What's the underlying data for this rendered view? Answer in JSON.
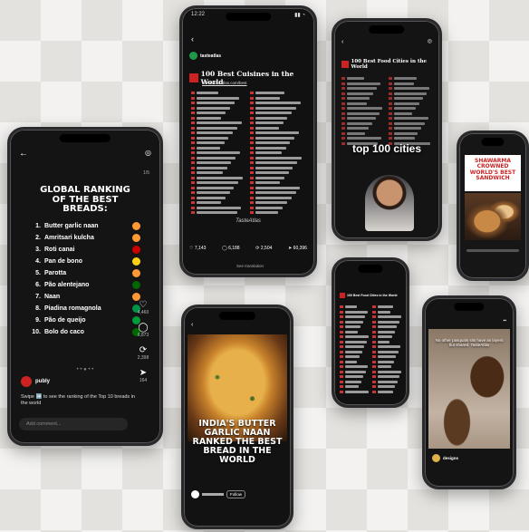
{
  "phone1": {
    "heading_line1": "GLOBAL RANKING",
    "heading_line2": "OF THE BEST BREADS:",
    "breads": [
      {
        "rank": "1.",
        "name": "Butter garlic naan",
        "color": "#ff9933"
      },
      {
        "rank": "2.",
        "name": "Amritsari kulcha",
        "color": "#ff9933"
      },
      {
        "rank": "3.",
        "name": "Roti canai",
        "color": "#cc0001"
      },
      {
        "rank": "4.",
        "name": "Pan de bono",
        "color": "#fcd116"
      },
      {
        "rank": "5.",
        "name": "Parotta",
        "color": "#ff9933"
      },
      {
        "rank": "6.",
        "name": "Pão alentejano",
        "color": "#006600"
      },
      {
        "rank": "7.",
        "name": "Naan",
        "color": "#ff9933"
      },
      {
        "rank": "8.",
        "name": "Piadina romagnola",
        "color": "#009246"
      },
      {
        "rank": "9.",
        "name": "Pão de queijo",
        "color": "#009c3b"
      },
      {
        "rank": "10.",
        "name": "Bolo do caco",
        "color": "#006600"
      }
    ],
    "account": "publy",
    "caption": "Swipe ➡️ to see the ranking of the Top 10 breads in the world",
    "comment_placeholder": "Add comment...",
    "counts": {
      "likes": "4,460",
      "comments": "6,873",
      "reposts": "2,398",
      "sends": "164"
    },
    "page_indicator": "1/5"
  },
  "phone2": {
    "time": "12:22",
    "account": "tasteatlas",
    "title": "100 Best Cuisines in the World",
    "url": "www.tasteatlas.com/best",
    "counts": {
      "likes": "7,143",
      "comments": "6,188",
      "reposts": "2,504",
      "sends": "60,396"
    },
    "logo": "TasteAtlas",
    "footer": "See translation"
  },
  "phone3": {
    "title": "100 Best Food Cities in the World",
    "overlay": "top 100 cities"
  },
  "phone4": {
    "headline": "SHAWARMA CROWNED WORLD'S BEST SANDWICH"
  },
  "phone5": {
    "title": "100 Best Food Cities in the World"
  },
  "phone6": {
    "headline": "INDIA'S BUTTER GARLIC NAAN RANKED THE BEST BREAD IN THE WORLD",
    "follow": "Follow"
  },
  "phone7": {
    "caption": "No other pasquals sits have as layers but shared. TasteAtlas",
    "account": "designs"
  }
}
